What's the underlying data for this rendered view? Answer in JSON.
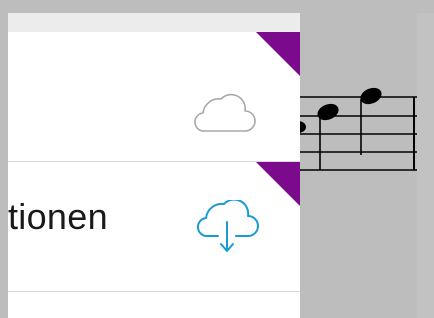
{
  "list": {
    "rows": [
      {
        "label": "",
        "cloud_icon": "cloud-outline-icon",
        "status": "not-downloaded"
      },
      {
        "label": "tionen",
        "cloud_icon": "cloud-download-icon",
        "status": "download-available"
      },
      {
        "label": "",
        "cloud_icon": "",
        "status": ""
      }
    ]
  },
  "colors": {
    "corner_badge": "#7b0a8c",
    "cloud_grey": "#a8a8a8",
    "cloud_blue": "#1a9bd6",
    "background": "#bdbdbd",
    "row_background": "#ffffff",
    "header_background": "#ececec",
    "notation": "#000000"
  }
}
